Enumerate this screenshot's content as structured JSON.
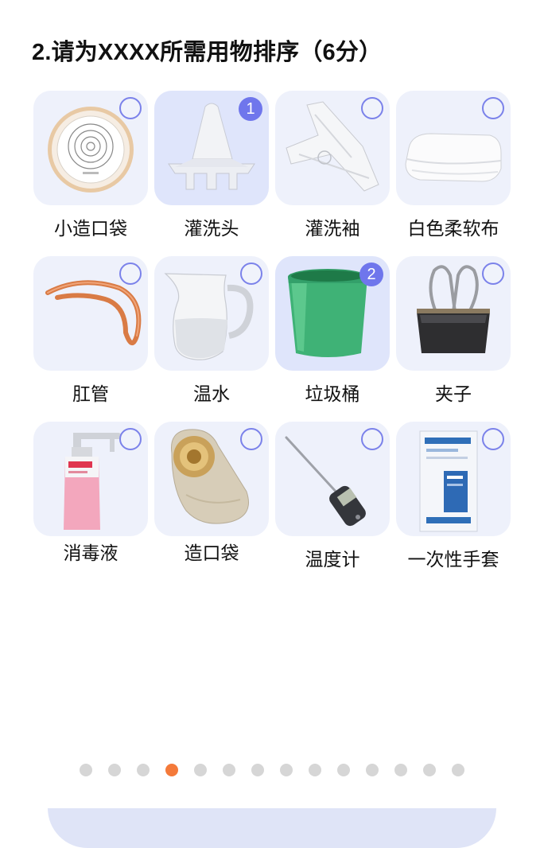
{
  "question": {
    "title": "2.请为XXXX所需用物排序（6分）"
  },
  "items": [
    {
      "label": "小造口袋",
      "icon": "small-ostomy-bag-image",
      "order": ""
    },
    {
      "label": "灌洗头",
      "icon": "irrigation-cone-image",
      "order": "1"
    },
    {
      "label": "灌洗袖",
      "icon": "irrigation-sleeve-image",
      "order": ""
    },
    {
      "label": "白色柔软布",
      "icon": "soft-white-cloth-image",
      "order": ""
    },
    {
      "label": "肛管",
      "icon": "rectal-tube-image",
      "order": ""
    },
    {
      "label": "温水",
      "icon": "warm-water-pitcher-image",
      "order": ""
    },
    {
      "label": "垃圾桶",
      "icon": "trash-bin-image",
      "order": "2"
    },
    {
      "label": "夹子",
      "icon": "binder-clip-image",
      "order": ""
    },
    {
      "label": "消毒液",
      "icon": "disinfectant-bottle-image",
      "order": ""
    },
    {
      "label": "造口袋",
      "icon": "ostomy-bag-image",
      "order": ""
    },
    {
      "label": "温度计",
      "icon": "thermometer-image",
      "order": ""
    },
    {
      "label": "一次性手套",
      "icon": "disposable-gloves-image",
      "order": ""
    }
  ],
  "pagination": {
    "total": 14,
    "active_index": 3
  },
  "colors": {
    "accent": "#6f76ec",
    "active_dot": "#f47a3a",
    "tile_bg": "#eef1fb"
  }
}
